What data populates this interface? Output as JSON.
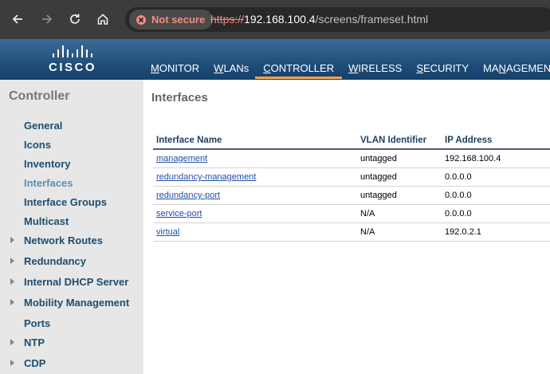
{
  "browser": {
    "security_label": "Not secure",
    "url_scheme": "https://",
    "url_host": "192.168.100.4",
    "url_path": "/screens/frameset.html"
  },
  "header": {
    "logo_text": "CISCO",
    "menu": [
      {
        "label": "MONITOR",
        "first": "M",
        "rest": "ONITOR",
        "active": false
      },
      {
        "label": "WLANs",
        "first": "W",
        "rest": "LANs",
        "active": false
      },
      {
        "label": "CONTROLLER",
        "first": "C",
        "rest": "ONTROLLER",
        "active": true
      },
      {
        "label": "WIRELESS",
        "first": "W",
        "rest": "IRELESS",
        "active": false
      },
      {
        "label": "SECURITY",
        "first": "S",
        "rest": "ECURITY",
        "active": false
      },
      {
        "label": "MANAGEMENT",
        "first": "MA",
        "ul": "N",
        "rest": "AGEMENT",
        "active": false
      }
    ]
  },
  "sidebar": {
    "title": "Controller",
    "items": [
      {
        "label": "General",
        "expandable": false
      },
      {
        "label": "Icons",
        "expandable": false
      },
      {
        "label": "Inventory",
        "expandable": false
      },
      {
        "label": "Interfaces",
        "expandable": false,
        "active": true
      },
      {
        "label": "Interface Groups",
        "expandable": false
      },
      {
        "label": "Multicast",
        "expandable": false
      },
      {
        "label": "Network Routes",
        "expandable": true
      },
      {
        "label": "Redundancy",
        "expandable": true
      },
      {
        "label": "Internal DHCP Server",
        "expandable": true
      },
      {
        "label": "Mobility Management",
        "expandable": true
      },
      {
        "label": "Ports",
        "expandable": false
      },
      {
        "label": "NTP",
        "expandable": true
      },
      {
        "label": "CDP",
        "expandable": true
      }
    ]
  },
  "main": {
    "title": "Interfaces",
    "columns": [
      "Interface Name",
      "VLAN Identifier",
      "IP Address"
    ],
    "rows": [
      {
        "name": "management",
        "vlan": "untagged",
        "ip": "192.168.100.4"
      },
      {
        "name": "redundancy-management",
        "vlan": "untagged",
        "ip": "0.0.0.0"
      },
      {
        "name": "redundancy-port",
        "vlan": "untagged",
        "ip": "0.0.0.0"
      },
      {
        "name": "service-port",
        "vlan": "N/A",
        "ip": "0.0.0.0"
      },
      {
        "name": "virtual",
        "vlan": "N/A",
        "ip": "192.0.2.1"
      }
    ]
  },
  "colors": {
    "header_blue": "#1d4a76",
    "active_tab_underline": "#f7a34d",
    "sidebar_link": "#1e4d6e",
    "warning_red": "#f28b82"
  }
}
